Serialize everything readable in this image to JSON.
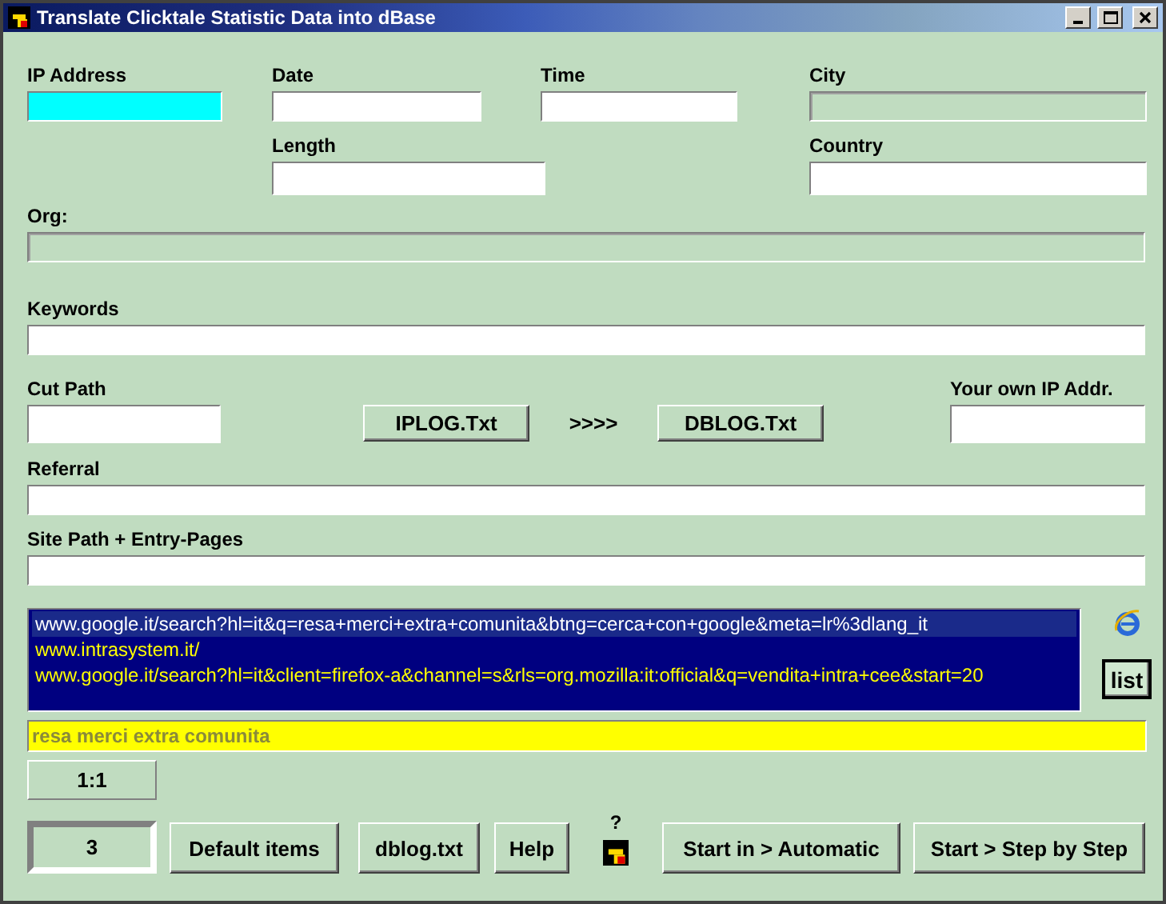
{
  "window": {
    "title": "Translate Clicktale Statistic Data into dBase"
  },
  "ip_address": {
    "label": "IP Address",
    "highlighted": true,
    "disabled": false
  },
  "date": {
    "label": "Date",
    "highlighted": false,
    "disabled": false
  },
  "time": {
    "label": "Time",
    "highlighted": false,
    "disabled": false
  },
  "city": {
    "label": "City",
    "highlighted": false,
    "disabled": true
  },
  "length": {
    "label": "Length",
    "highlighted": false,
    "disabled": false
  },
  "country": {
    "label": "Country",
    "highlighted": false,
    "disabled": false
  },
  "org": {
    "label": "Org:",
    "highlighted": false,
    "disabled": true
  },
  "keywords": {
    "label": "Keywords",
    "highlighted": false,
    "disabled": false
  },
  "cut_path": {
    "label": "Cut Path",
    "highlighted": false,
    "disabled": false
  },
  "iplog_button": "IPLOG.Txt",
  "arrow_text": ">>>>",
  "dblog_button": "DBLOG.Txt",
  "own_ip": {
    "label": "Your own IP Addr.",
    "highlighted": false,
    "disabled": false
  },
  "referral": {
    "label": "Referral",
    "highlighted": false,
    "disabled": false
  },
  "site_path": {
    "label": "Site Path + Entry-Pages",
    "highlighted": false,
    "disabled": false
  },
  "history_list": [
    {
      "text": "www.google.it/search?hl=it&q=resa+merci+extra+comunita&btng=cerca+con+google&meta=lr%3dlang_it",
      "selected": true
    },
    {
      "text": "www.intrasystem.it/",
      "selected": false
    },
    {
      "text": "www.google.it/search?hl=it&client=firefox-a&channel=s&rls=org.mozilla:it:official&q=vendita+intra+cee&start=20",
      "selected": false
    }
  ],
  "list_button": "list",
  "search_phrase": {
    "value": "resa merci extra comunita"
  },
  "ratio": "1:1",
  "counter": "3",
  "left_buttons": [
    "Default items",
    "dblog.txt",
    "Help"
  ],
  "help_mark": "?",
  "right_buttons": [
    "Start in > Automatic",
    "Start > Step by Step"
  ]
}
